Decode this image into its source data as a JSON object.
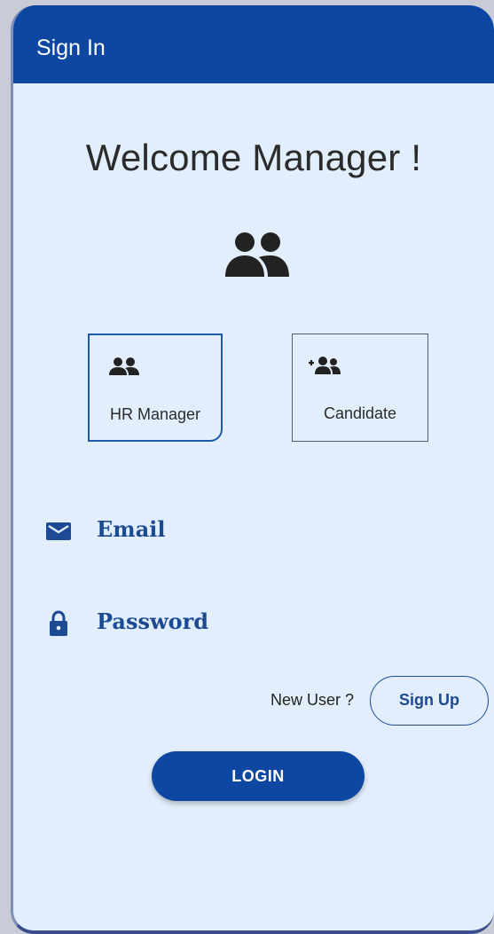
{
  "app_bar": {
    "title": "Sign In"
  },
  "welcome": {
    "text": "Welcome Manager !"
  },
  "roles": [
    {
      "label": "HR Manager",
      "icon": "group-icon",
      "selected": true
    },
    {
      "label": "Candidate",
      "icon": "add-group-icon",
      "selected": false
    }
  ],
  "form": {
    "email_label": "Email",
    "password_label": "Password"
  },
  "signup": {
    "prompt": "New User ?",
    "button": "Sign Up"
  },
  "login": {
    "button": "LOGIN"
  },
  "colors": {
    "primary": "#0d47a1",
    "background": "#e2eefb",
    "label": "#1c4a93"
  }
}
